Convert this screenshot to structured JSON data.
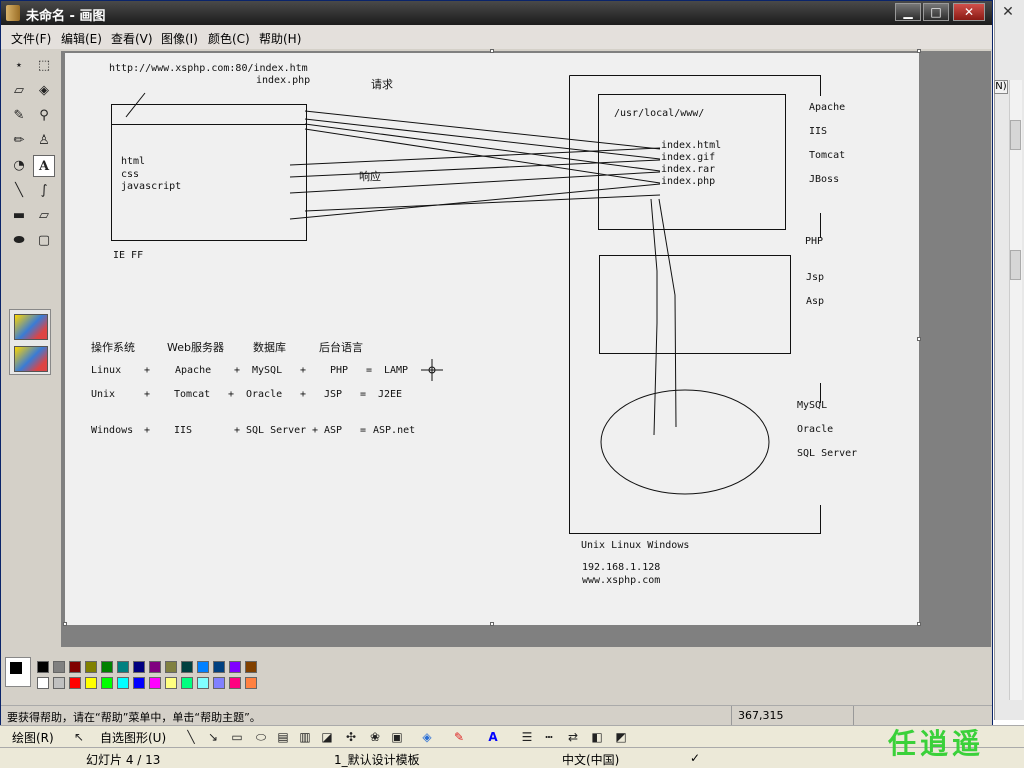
{
  "window": {
    "title": "未命名 - 画图",
    "minimize_label": "▁",
    "maximize_label": "□",
    "close_label": "✕"
  },
  "menu": [
    "文件(F)",
    "编辑(E)",
    "查看(V)",
    "图像(I)",
    "颜色(C)",
    "帮助(H)"
  ],
  "tools": [
    "free-select",
    "rect-select",
    "eraser",
    "fill-bucket",
    "color-picker",
    "magnifier",
    "pencil",
    "brush",
    "airbrush",
    "text",
    "line",
    "curve",
    "rectangle",
    "polygon",
    "ellipse",
    "rounded-rectangle"
  ],
  "canvas": {
    "url_line1": "http://www.xsphp.com:80/index.htm",
    "url_line2": "index.php",
    "request": "请求",
    "response": "响应",
    "browser_contents": [
      "html",
      "css",
      "javascript"
    ],
    "browsers": "IE FF",
    "server_path": "/usr/local/www/",
    "server_files": [
      "index.html",
      "index.gif",
      "index.rar",
      "index.php"
    ],
    "web_servers": [
      "Apache",
      "IIS",
      "Tomcat",
      "JBoss"
    ],
    "languages": [
      "PHP",
      "Jsp",
      "Asp"
    ],
    "databases": [
      "MySQL",
      "Oracle",
      "SQL Server"
    ],
    "os": "Unix  Linux Windows",
    "ip": "192.168.1.128",
    "domain": "www.xsphp.com",
    "table_header": [
      "操作系统",
      "Web服务器",
      "数据库",
      "后台语言"
    ],
    "row1": [
      "Linux",
      "+",
      "Apache",
      "+",
      "MySQL",
      "+",
      "PHP",
      "=",
      "LAMP"
    ],
    "row2": [
      "Unix",
      "+",
      "Tomcat",
      "+",
      "Oracle",
      "+",
      "JSP",
      "=",
      "J2EE"
    ],
    "row3": [
      "Windows",
      "+",
      "IIS",
      "+",
      "SQL Server",
      "+",
      "ASP",
      "=",
      "ASP.net"
    ]
  },
  "palette": [
    "#000000",
    "#808080",
    "#800000",
    "#808000",
    "#008000",
    "#008080",
    "#000080",
    "#800080",
    "#808040",
    "#004040",
    "#0080ff",
    "#004080",
    "#8000ff",
    "#804000",
    "#ffffff",
    "#c0c0c0",
    "#ff0000",
    "#ffff00",
    "#00ff00",
    "#00ffff",
    "#0000ff",
    "#ff00ff",
    "#ffff80",
    "#00ff80",
    "#80ffff",
    "#8080ff",
    "#ff0080",
    "#ff8040"
  ],
  "status": {
    "message": "要获得帮助，请在“帮助”菜单中，单击“帮助主题”。",
    "coords": "367,315"
  },
  "drawbar": {
    "draw_label": "绘图(R)",
    "autoshape_label": "自选图形(U)"
  },
  "pptstatus": {
    "slide": "幻灯片 4 / 13",
    "template": "1_默认设计模板",
    "language": "中文(中国)"
  },
  "watermark": "任逍遥"
}
